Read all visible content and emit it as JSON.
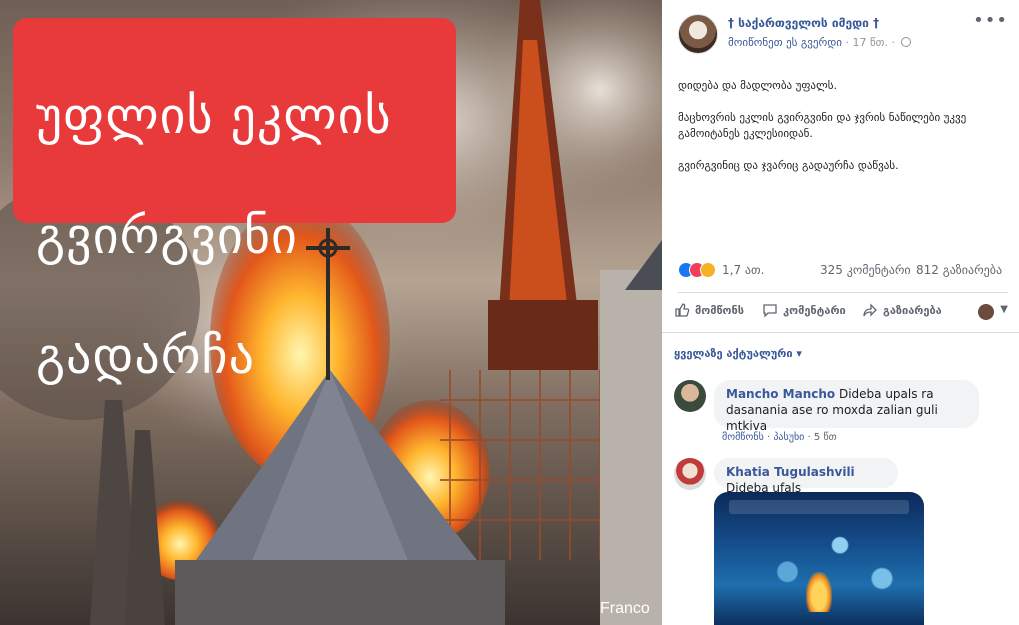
{
  "photo": {
    "overlay_lines": [
      "უფლის ეკლის",
      "გვირგვინი",
      "გადარჩა"
    ],
    "credit": "Franco"
  },
  "post": {
    "page_name": "† საქართველოს იმედი †",
    "like_page": "მოიწონეთ ეს გვერდი",
    "time": "17 წთ.",
    "more": "•••",
    "body": [
      "დიდება და მადლობა უფალს.",
      "მაცხოვრის ეკლის გვირგვინი და ჯვრის ნაწილები უკვე გამოიტანეს ეკლესიიდან.",
      "გვირგვინიც და ჯვარიც გადაურჩა დაწვას."
    ],
    "reactions_count": "1,7 ათ.",
    "comments_count": "325 კომენტარი",
    "shares_count": "812 გაზიარება",
    "actions": {
      "like": "მომწონს",
      "comment": "კომენტარი",
      "share": "გაზიარება"
    }
  },
  "comments_section": {
    "sort_label": "ყველაზე აქტუალური ▾",
    "items": [
      {
        "author": "Mancho Mancho",
        "text": " Dideba upals ra dasanania ase ro moxda zalian guli mtkiva",
        "like_label": "მომწონს",
        "reply_label": "პასუხი",
        "time": "5 წთ"
      },
      {
        "author": "Khatia Tugulashvili",
        "text": " Dideba ufals"
      }
    ]
  },
  "colors": {
    "overlay_red": "#e8393b",
    "link_blue": "#385898",
    "like_blue": "#1877f2"
  }
}
